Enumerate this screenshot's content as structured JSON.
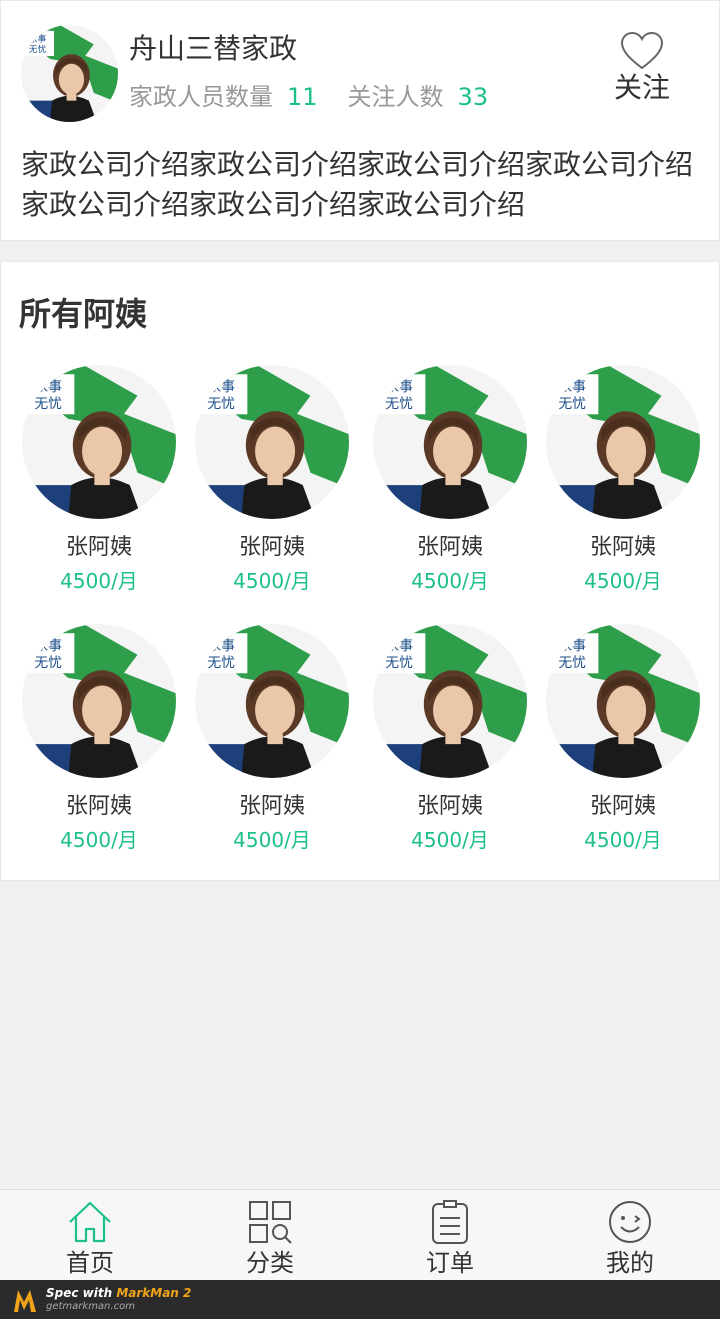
{
  "company": {
    "name": "舟山三替家政",
    "staff_label": "家政人员数量",
    "staff_count": "11",
    "followers_label": "关注人数",
    "followers_count": "33",
    "follow_label": "关注",
    "intro": "家政公司介绍家政公司介绍家政公司介绍家政公司介绍家政公司介绍家政公司介绍家政公司介绍"
  },
  "aunts_section": {
    "title": "所有阿姨",
    "items": [
      {
        "name": "张阿姨",
        "price": "4500/月"
      },
      {
        "name": "张阿姨",
        "price": "4500/月"
      },
      {
        "name": "张阿姨",
        "price": "4500/月"
      },
      {
        "name": "张阿姨",
        "price": "4500/月"
      },
      {
        "name": "张阿姨",
        "price": "4500/月"
      },
      {
        "name": "张阿姨",
        "price": "4500/月"
      },
      {
        "name": "张阿姨",
        "price": "4500/月"
      },
      {
        "name": "张阿姨",
        "price": "4500/月"
      }
    ]
  },
  "tabbar": {
    "tabs": [
      {
        "label": "首页",
        "icon": "home-icon",
        "active": true
      },
      {
        "label": "分类",
        "icon": "category-icon",
        "active": false
      },
      {
        "label": "订单",
        "icon": "order-icon",
        "active": false
      },
      {
        "label": "我的",
        "icon": "profile-icon",
        "active": false
      }
    ]
  },
  "brand": {
    "line1_prefix": "Spec with ",
    "line1_accent": "MarkMan 2",
    "line2": "getmarkman.com"
  },
  "colors": {
    "accent": "#1dbf8a",
    "text": "#333333",
    "muted": "#999999",
    "background": "#f0f0f0"
  }
}
